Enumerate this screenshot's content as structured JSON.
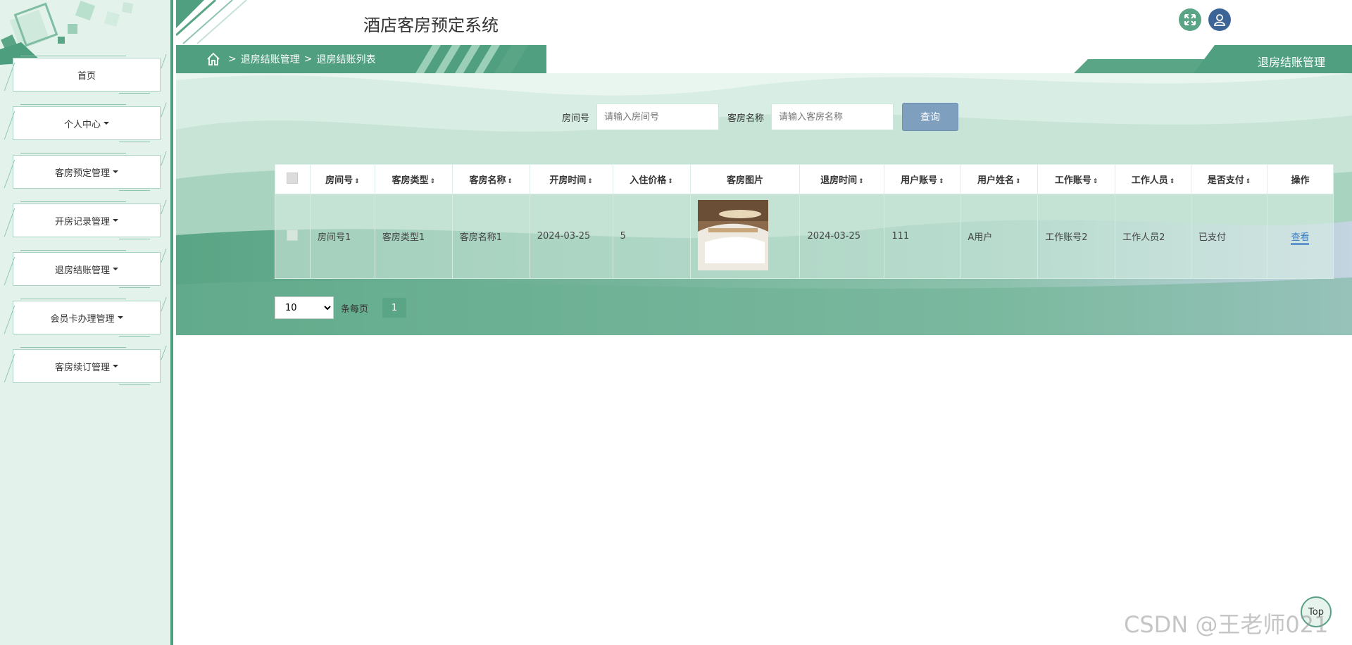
{
  "app": {
    "title": "酒店客房预定系统"
  },
  "sidebar": {
    "items": [
      {
        "label": "首页",
        "caret": false
      },
      {
        "label": "个人中心",
        "caret": true
      },
      {
        "label": "客房预定管理",
        "caret": true
      },
      {
        "label": "开房记录管理",
        "caret": true
      },
      {
        "label": "退房结账管理",
        "caret": true
      },
      {
        "label": "会员卡办理管理",
        "caret": true
      },
      {
        "label": "客房续订管理",
        "caret": true
      }
    ]
  },
  "breadcrumb": {
    "sep": ">",
    "level1": "退房结账管理",
    "level2": "退房结账列表"
  },
  "right_tab": {
    "label": "退房结账管理"
  },
  "search": {
    "room_no_label": "房间号",
    "room_no_placeholder": "请输入房间号",
    "room_name_label": "客房名称",
    "room_name_placeholder": "请输入客房名称",
    "query_label": "查询"
  },
  "table": {
    "headers": [
      "房间号",
      "客房类型",
      "客房名称",
      "开房时间",
      "入住价格",
      "客房图片",
      "退房时间",
      "用户账号",
      "用户姓名",
      "工作账号",
      "工作人员",
      "是否支付",
      "操作"
    ],
    "rows": [
      {
        "room_no": "房间号1",
        "room_type": "客房类型1",
        "room_name": "客房名称1",
        "checkin_time": "2024-03-25",
        "price": "5",
        "checkout_time": "2024-03-25",
        "user_account": "111",
        "user_name": "A用户",
        "staff_account": "工作账号2",
        "staff_name": "工作人员2",
        "paid": "已支付",
        "action": "查看"
      }
    ]
  },
  "pager": {
    "page_size": "10",
    "per_page_label": "条每页",
    "current_page": "1"
  },
  "top_button": {
    "label": "Top"
  },
  "watermark": {
    "text": "CSDN @王老师021"
  },
  "colors": {
    "primary": "#4f9f80",
    "sidebar_bg": "#e3f3ec",
    "query_btn": "#7f9fbf",
    "link": "#3a7cc4"
  },
  "icons": {
    "fullscreen": "expand-icon",
    "user": "user-icon",
    "home": "home-icon"
  }
}
